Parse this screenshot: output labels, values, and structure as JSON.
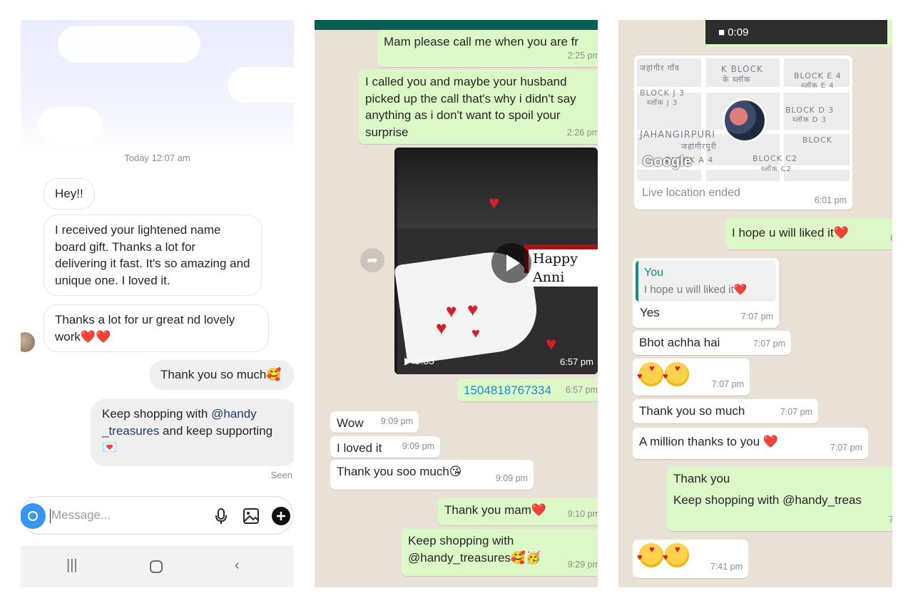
{
  "panel1": {
    "timestamp": "Today 12:07 am",
    "incoming": [
      "Hey!!",
      "I received your lightened name board gift. Thanks a lot for delivering it fast. It's so amazing and unique one. I loved it.",
      "Thanks a lot for ur great nd lovely work❤️❤️"
    ],
    "outgoing1": "Thank you so much🥰",
    "outgoing2_part1": "Keep shopping with ",
    "outgoing2_mention": "@handy _treasures",
    "outgoing2_part2": " and keep supporting 💌",
    "seen": "Seen",
    "composer_placeholder": "Message...",
    "icons": [
      "camera-icon",
      "microphone-icon",
      "gallery-icon",
      "add-icon",
      "recents-icon",
      "home-icon",
      "back-icon"
    ]
  },
  "panel2": {
    "messages": [
      {
        "text": "Mam please call me when you are fr",
        "time": "2:25 pm"
      },
      {
        "text": "I called you and maybe your husband picked up the call that's why i didn't say anything as i don't want to spoil your surprise",
        "time": "2:26 pm"
      }
    ],
    "video": {
      "duration": "5:33",
      "time": "6:57 pm",
      "banner_text": "Happy Anni"
    },
    "link_message": {
      "text": "1504818767334",
      "time": "6:57 pm"
    },
    "incoming": [
      {
        "text": "Wow",
        "time": "9:09 pm"
      },
      {
        "text": "I loved it",
        "time": "9:09 pm"
      },
      {
        "text": "Thank you soo much😘",
        "time": "9:09 pm"
      }
    ],
    "outgoing_late": [
      {
        "text": "Thank you mam❤️",
        "time": "9:10 pm"
      },
      {
        "text": "Keep shopping with @handy_treasures🥰🥳",
        "time": "9:29 pm"
      }
    ]
  },
  "panel3": {
    "video_duration": "0:09",
    "map_labels": [
      "जहांगीर गाँव",
      "K BLOCK",
      "के ब्लॉक",
      "BLOCK E 4",
      "ब्लॉक E 4",
      "BLOCK J 3",
      "ब्लॉक J 3",
      "BLOCK D 3",
      "ब्लॉक D 3",
      "JAHANGIRPURI",
      "जहांगीरपुरी",
      "BLOCK",
      "BLOCK A 4",
      "BLOCK C2",
      "ब्लॉक C2"
    ],
    "map_brand": "Google",
    "live_location": {
      "text": "Live location ended",
      "time": "6:01 pm"
    },
    "outgoing": {
      "text": "I hope u will liked it❤️",
      "time": "6"
    },
    "reply": {
      "quote_name": "You",
      "quote_text": "I hope u will liked it❤️",
      "text": "Yes",
      "time": "7:07 pm"
    },
    "incoming": [
      {
        "text": "Bhot achha hai",
        "time": "7:07 pm"
      },
      {
        "text": "🥰🥰",
        "time": "7:07 pm"
      },
      {
        "text": "Thank you so much",
        "time": "7:07 pm"
      },
      {
        "text": "A million thanks to you ❤️",
        "time": "7:07 pm"
      }
    ],
    "outgoing_final": {
      "line1": "Thank you",
      "line2": "Keep shopping with @handy_treas",
      "time": "7"
    },
    "last_incoming": {
      "text": "🥰🥰",
      "time": "7:41 pm"
    }
  }
}
